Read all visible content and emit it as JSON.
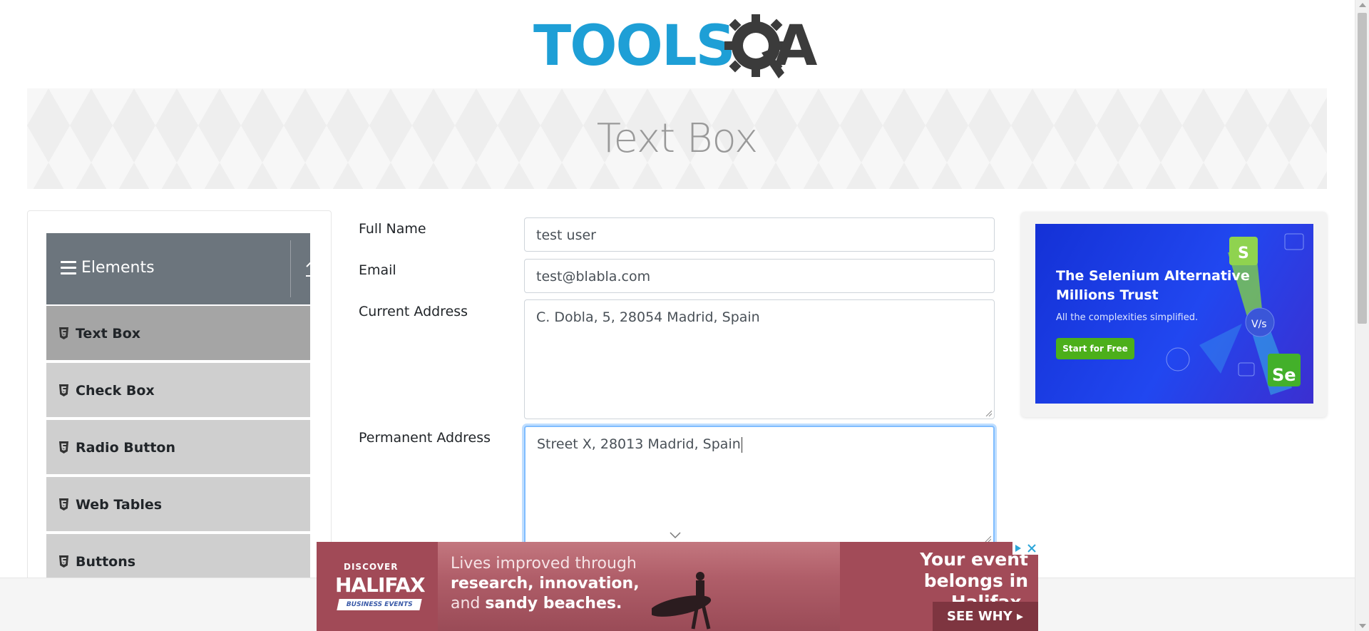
{
  "logo": {
    "text": "TOOLS",
    "accent": "A",
    "alt": "TOOLSQA"
  },
  "banner": {
    "title": "Text Box"
  },
  "sidebar": {
    "group_title": "Elements",
    "items": [
      {
        "label": "Text Box",
        "active": true
      },
      {
        "label": "Check Box",
        "active": false
      },
      {
        "label": "Radio Button",
        "active": false
      },
      {
        "label": "Web Tables",
        "active": false
      },
      {
        "label": "Buttons",
        "active": false
      }
    ]
  },
  "form": {
    "full_name": {
      "label": "Full Name",
      "value": "test user"
    },
    "email": {
      "label": "Email",
      "value": "test@blabla.com"
    },
    "current_address": {
      "label": "Current Address",
      "value": "C. Dobla, 5, 28054 Madrid, Spain"
    },
    "permanent_address": {
      "label": "Permanent Address",
      "value": "Street X, 28013 Madrid, Spain"
    }
  },
  "right_ad": {
    "headline": "The Selenium Alternative Millions Trust",
    "subline": "All the complexities simplified.",
    "cta": "Start for Free"
  },
  "bottom_ad": {
    "discover": "DISCOVER",
    "brand": "HALIFAX",
    "business_events": "BUSINESS EVENTS",
    "line1": "Lives improved through",
    "line2": "research, innovation,",
    "line3_prefix": "and ",
    "line3_bold": "sandy beaches.",
    "headline": "Your event belongs in Halifax.",
    "cta": "SEE WHY"
  },
  "colors": {
    "brand_blue": "#1e9fd6",
    "sidebar_header": "#6c757d",
    "menu_item": "#cfcfcf",
    "menu_item_active": "#a5a5a5",
    "focus_border": "#80bdff",
    "ad_blue": "#2147f0",
    "ad_green": "#4caf1a",
    "halifax_red": "#a24b58"
  },
  "icons": {
    "gear": "gear-icon",
    "hamburger": "hamburger-icon",
    "collapse": "collapse-up-icon",
    "menu_item": "html5-icon",
    "chevron": "chevron-down-icon"
  }
}
